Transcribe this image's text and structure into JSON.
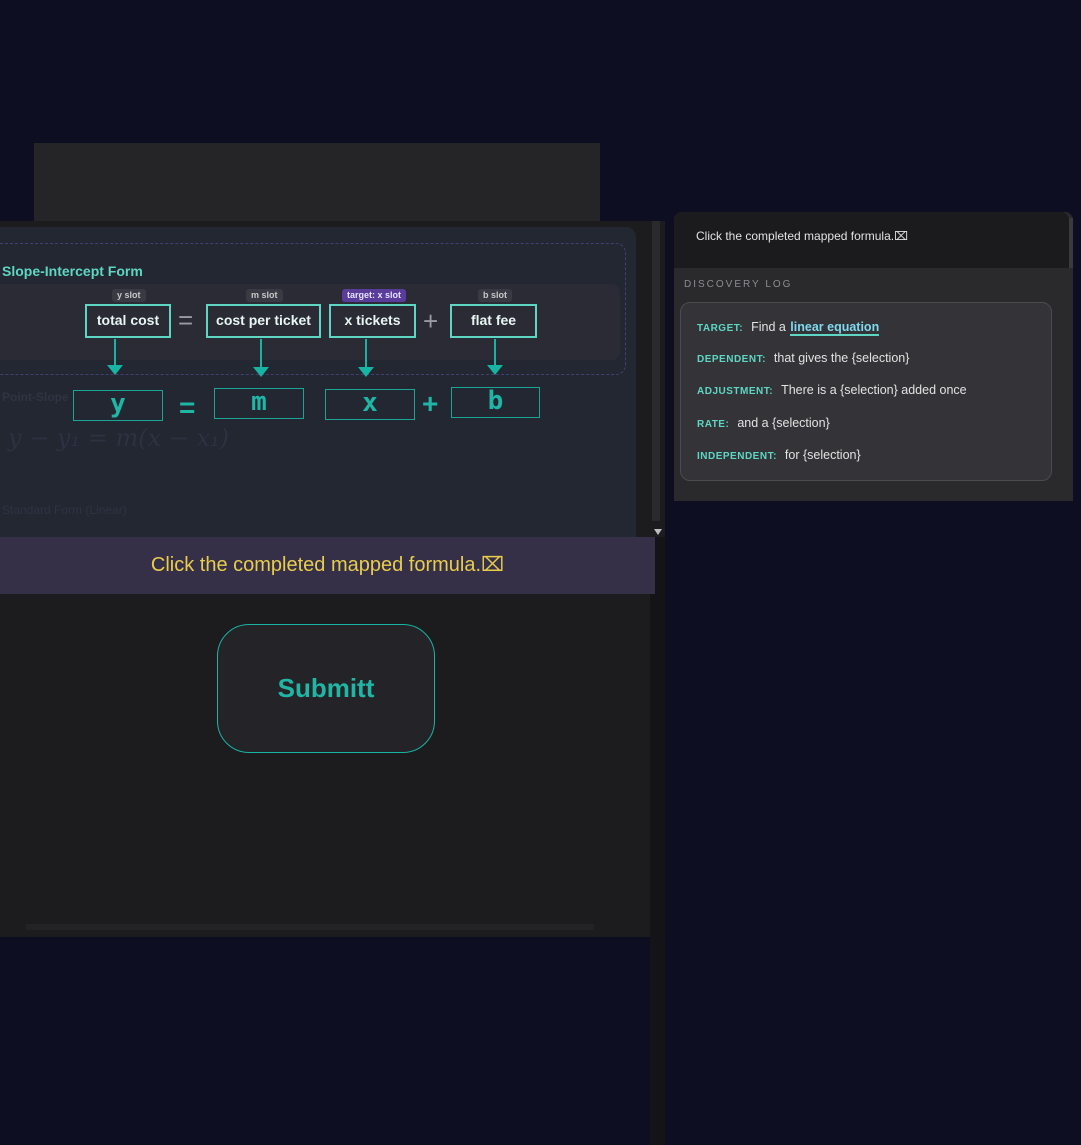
{
  "slope_intercept": {
    "title": "Slope-Intercept Form",
    "slots": [
      {
        "tag": "y slot",
        "label": "total cost"
      },
      {
        "tag": "m slot",
        "label": "cost per ticket"
      },
      {
        "tag": "target: x slot",
        "label": "x tickets"
      },
      {
        "tag": "b slot",
        "label": "flat fee"
      }
    ],
    "ops": [
      "=",
      "+"
    ],
    "symbols": [
      "y",
      "m",
      "x",
      "b"
    ],
    "sym_ops": [
      "=",
      "+"
    ]
  },
  "point_slope": {
    "title": "Point-Slope",
    "formula": "y − y₁ = m(x − x₁)"
  },
  "standard_form": {
    "title": "Standard Form (Linear)"
  },
  "banner": {
    "text": "Click the completed mapped formula.⌧"
  },
  "submit": {
    "label": "Submitt"
  },
  "sidebar": {
    "instruction": "Click the completed mapped formula.⌧",
    "log_title": "DISCOVERY LOG",
    "entries": [
      {
        "key": "TARGET:",
        "prefix": "Find a",
        "link": "linear equation"
      },
      {
        "key": "DEPENDENT:",
        "value": "that gives the {selection}"
      },
      {
        "key": "ADJUSTMENT:",
        "value": "There is a {selection} added once"
      },
      {
        "key": "RATE:",
        "value": "and a {selection}"
      },
      {
        "key": "INDEPENDENT:",
        "value": "for {selection}"
      }
    ]
  },
  "colors": {
    "background": "#0d0e21",
    "accent": "#5ed6c4",
    "banner_text": "#e8cd4d",
    "target_tag": "#5a3d9a"
  }
}
